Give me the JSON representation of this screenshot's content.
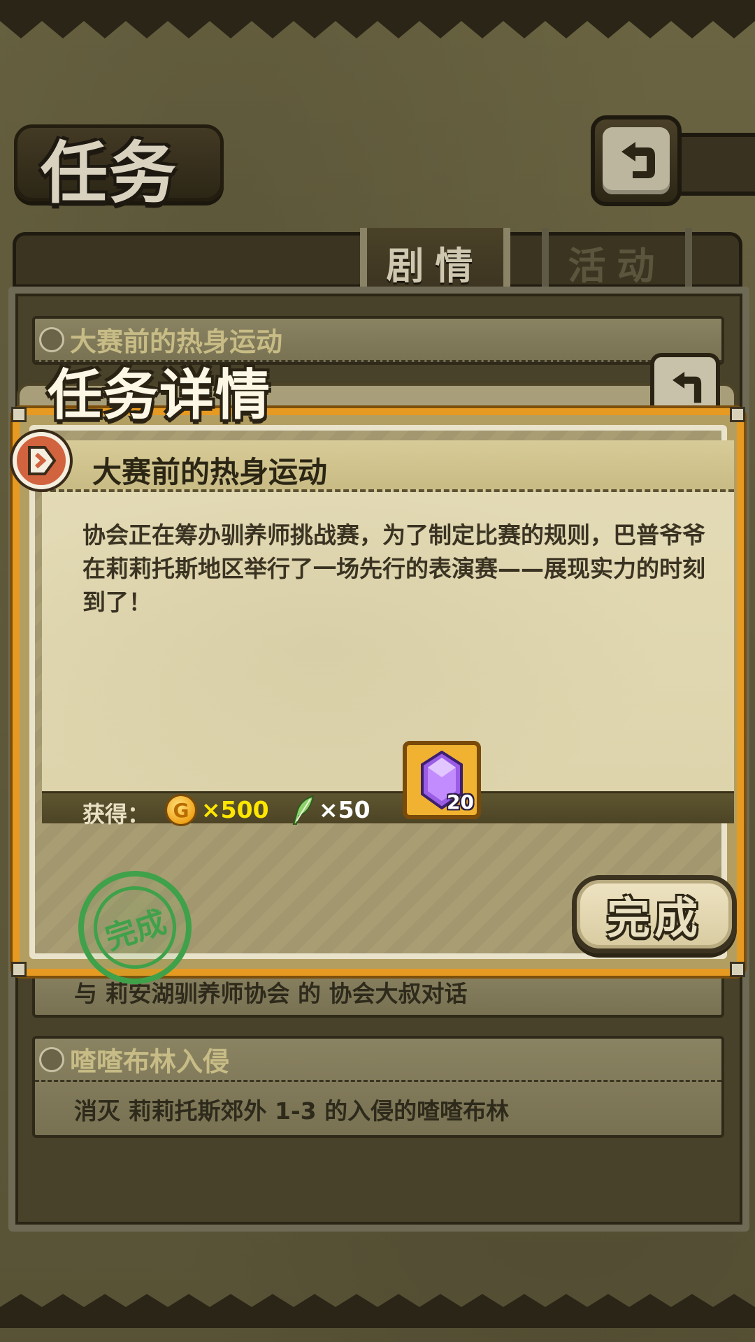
{
  "header": {
    "title": "任务"
  },
  "tabs": [
    {
      "label": "剧情",
      "active": true
    },
    {
      "label": "活动",
      "active": false
    }
  ],
  "quest_list": [
    {
      "title": "大赛前的热身运动",
      "objective": ""
    },
    {
      "title": "",
      "objective": "与 莉安湖驯养师协会 的 协会大叔对话"
    },
    {
      "title": "喳喳布林入侵",
      "objective": "消灭 莉莉托斯郊外 1-3 的入侵的喳喳布林"
    }
  ],
  "modal": {
    "title": "任务详情",
    "quest_title": "大赛前的热身运动",
    "description": "协会正在筹办驯养师挑战赛，为了制定比赛的规则，巴普爷爷在莉莉托斯地区举行了一场先行的表演赛——展现实力的时刻到了！",
    "reward_label": "获得：",
    "rewards": {
      "coin": {
        "icon": "gold-coin-icon",
        "symbol": "G",
        "amount": "×500"
      },
      "feather": {
        "icon": "feather-icon",
        "amount": "×50"
      },
      "gem": {
        "icon": "purple-gem-icon",
        "amount": "20"
      }
    },
    "stamp_text": "完成",
    "complete_button": "完成"
  },
  "colors": {
    "modal_border": "#e69a22",
    "coin_amount": "#ffe600",
    "stamp_green": "#3fa14a"
  }
}
